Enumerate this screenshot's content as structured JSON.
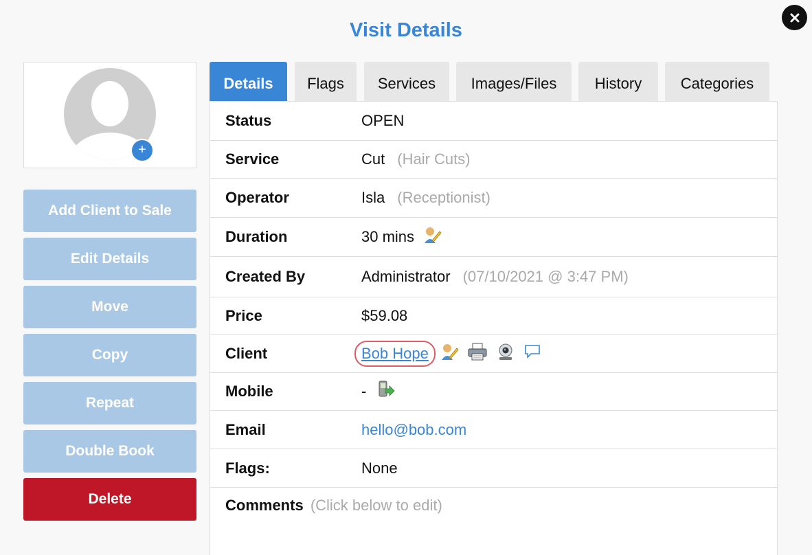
{
  "header": {
    "title": "Visit Details"
  },
  "sidebar": {
    "buttons": [
      {
        "label": "Add Client to Sale"
      },
      {
        "label": "Edit Details"
      },
      {
        "label": "Move"
      },
      {
        "label": "Copy"
      },
      {
        "label": "Repeat"
      },
      {
        "label": "Double Book"
      },
      {
        "label": "Delete"
      }
    ],
    "avatar_add_symbol": "+"
  },
  "tabs": [
    {
      "label": "Details",
      "active": true
    },
    {
      "label": "Flags"
    },
    {
      "label": "Services"
    },
    {
      "label": "Images/Files"
    },
    {
      "label": "History"
    },
    {
      "label": "Categories"
    }
  ],
  "details": {
    "status": {
      "label": "Status",
      "value": "OPEN"
    },
    "service": {
      "label": "Service",
      "value": "Cut",
      "note": "(Hair Cuts)"
    },
    "operator": {
      "label": "Operator",
      "value": "Isla",
      "note": "(Receptionist)"
    },
    "duration": {
      "label": "Duration",
      "value": "30 mins"
    },
    "created_by": {
      "label": "Created By",
      "value": "Administrator",
      "note": "(07/10/2021 @ 3:47 PM)"
    },
    "price": {
      "label": "Price",
      "value": "$59.08"
    },
    "client": {
      "label": "Client",
      "value": "Bob Hope"
    },
    "mobile": {
      "label": "Mobile",
      "value": "-"
    },
    "email": {
      "label": "Email",
      "value": "hello@bob.com"
    },
    "flags": {
      "label": "Flags:",
      "value": "None"
    },
    "comments": {
      "label": "Comments",
      "hint": "(Click below to edit)"
    }
  },
  "colors": {
    "accent": "#3a86d6",
    "button_disabled": "#a9c8e6",
    "danger": "#bf1727",
    "highlight": "#e05a63"
  }
}
